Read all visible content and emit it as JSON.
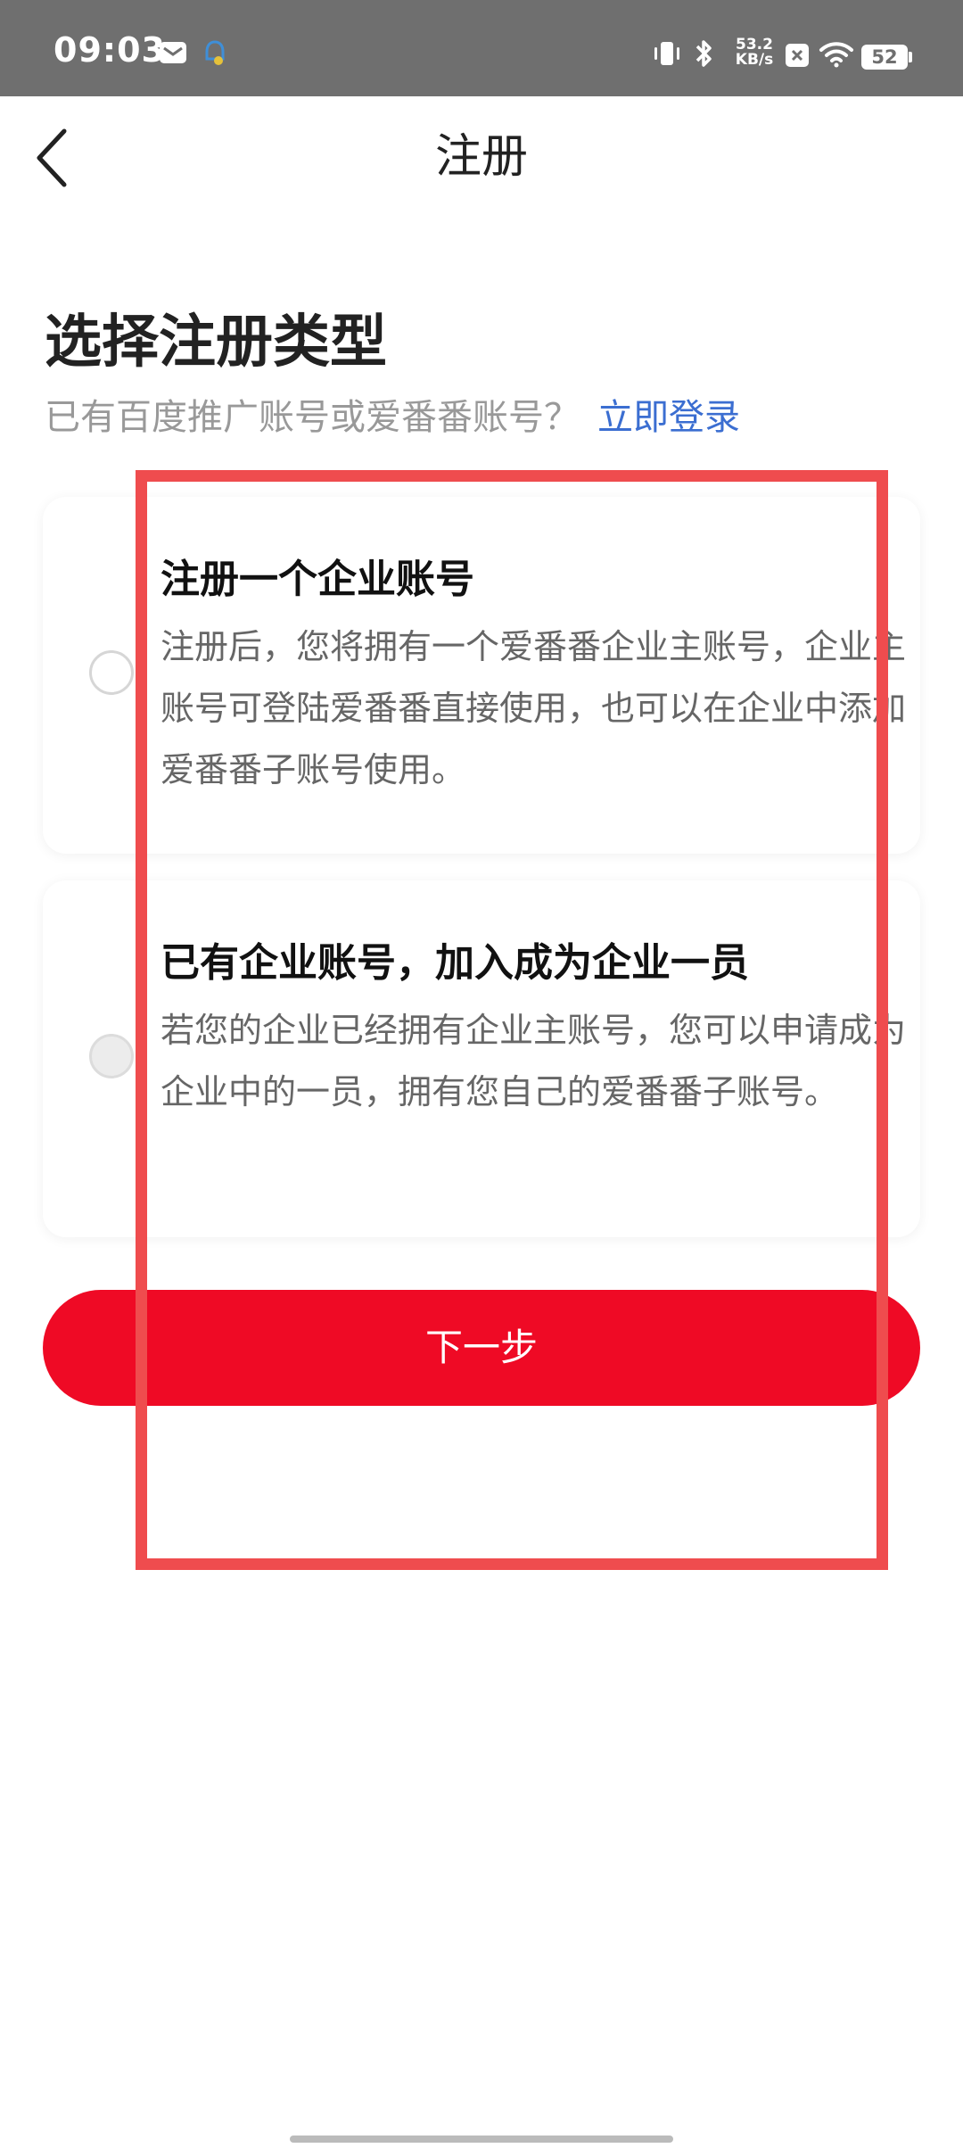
{
  "status_bar": {
    "time": "09:03",
    "net_speed_value": "53.2",
    "net_speed_unit": "KB/s",
    "battery": "52",
    "icons": [
      "mail-icon",
      "alarm-icon",
      "vibrate-icon",
      "bluetooth-icon",
      "box-icon",
      "wifi-icon",
      "battery-icon"
    ]
  },
  "nav": {
    "back_icon": "chevron-left-icon",
    "title": "注册"
  },
  "heading": "选择注册类型",
  "subtitle": {
    "text": "已有百度推广账号或爱番番账号？",
    "link": "立即登录",
    "link_color": "#3b6ed1"
  },
  "options": [
    {
      "title": "注册一个企业账号",
      "description": "注册后，您将拥有一个爱番番企业主账号，企业主账号可登陆爱番番直接使用，也可以在企业中添加爱番番子账号使用。",
      "selected": false
    },
    {
      "title": "已有企业账号，加入成为企业一员",
      "description": "若您的企业已经拥有企业主账号，您可以申请成为企业中的一员，拥有您自己的爱番番子账号。",
      "selected": false
    }
  ],
  "primary_button": {
    "label": "下一步",
    "color": "#ef0a25"
  },
  "highlight_color": "#ef4c4e"
}
